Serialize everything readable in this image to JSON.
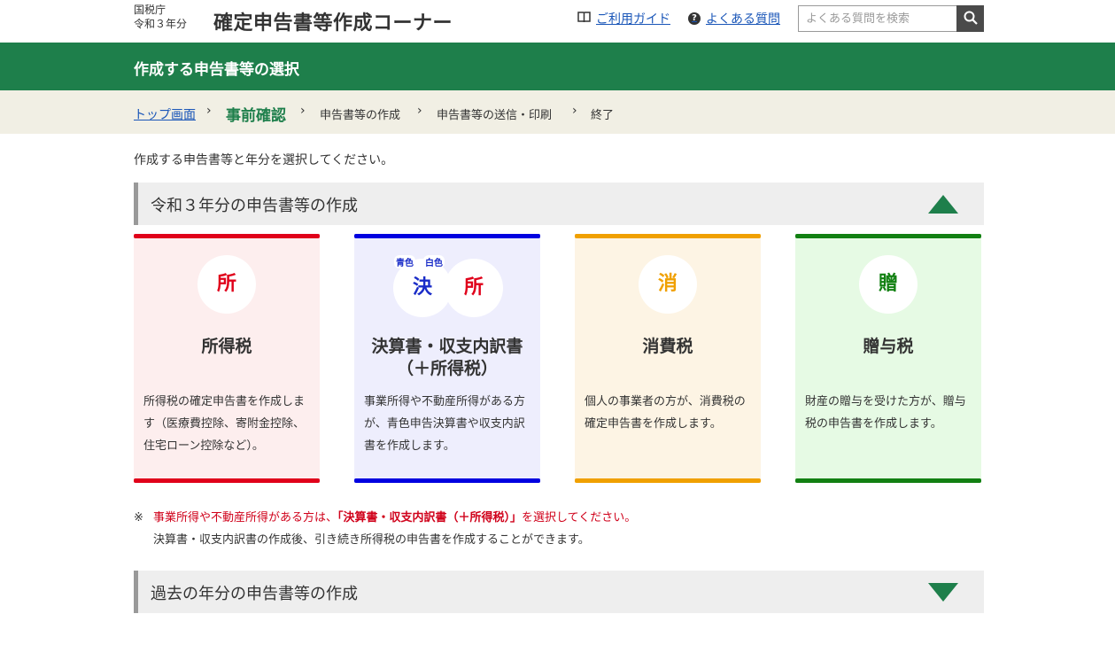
{
  "header": {
    "agency_line1": "国税庁",
    "agency_line2": "令和３年分",
    "site_title": "確定申告書等作成コーナー",
    "guide_link": "ご利用ガイド",
    "faq_link": "よくある質問",
    "search_placeholder": "よくある質問を検索",
    "icons": {
      "guide": "book-icon",
      "faq": "question-icon",
      "search": "search-icon"
    }
  },
  "banner": {
    "title": "作成する申告書等の選択"
  },
  "steps": {
    "top": "トップ画面",
    "current": "事前確認",
    "create": "申告書等の作成",
    "send": "申告書等の送信・印刷",
    "end": "終了"
  },
  "intro": "作成する申告書等と年分を選択してください。",
  "section_current": {
    "title": "令和３年分の申告書等の作成",
    "state": "expanded"
  },
  "cards": [
    {
      "icon_char": "所",
      "title": "所得税",
      "desc": "所得税の確定申告書を作成します（医療費控除、寄附金控除、住宅ローン控除など）。",
      "color": "#e0001a"
    },
    {
      "icon_char1": "決",
      "icon_char2": "所",
      "label_blue": "青色",
      "label_white": "白色",
      "title_line1": "決算書・収支内訳書",
      "title_line2": "（＋所得税）",
      "desc": "事業所得や不動産所得がある方が、青色申告決算書や収支内訳書を作成します。",
      "color": "#0000e0"
    },
    {
      "icon_char": "消",
      "title": "消費税",
      "desc": "個人の事業者の方が、消費税の確定申告書を作成します。",
      "color": "#f0a000"
    },
    {
      "icon_char": "贈",
      "title": "贈与税",
      "desc": "財産の贈与を受けた方が、贈与税の申告書を作成します。",
      "color": "#128012"
    }
  ],
  "note": {
    "mark": "※",
    "line1_pre": "事業所得や不動産所得がある方は、",
    "line1_bold": "「決算書・収支内訳書（＋所得税）」",
    "line1_post": "を選択してください。",
    "line2": "決算書・収支内訳書の作成後、引き続き所得税の申告書を作成することができます。"
  },
  "section_past": {
    "title": "過去の年分の申告書等の作成",
    "state": "collapsed"
  }
}
